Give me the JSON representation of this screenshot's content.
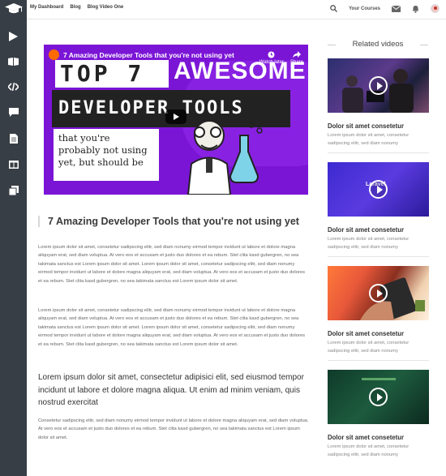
{
  "topbar": {
    "links": [
      "My Dashboard",
      "Blog",
      "Blog Video One"
    ],
    "courses_label": "Your Courses"
  },
  "sidebar": {
    "items": [
      {
        "icon": "play-icon"
      },
      {
        "icon": "book-icon"
      },
      {
        "icon": "code-icon"
      },
      {
        "icon": "chat-icon"
      },
      {
        "icon": "document-icon"
      },
      {
        "icon": "columns-icon"
      },
      {
        "icon": "copy-icon"
      }
    ]
  },
  "video": {
    "title": "7 Amazing Developer Tools that you're not using yet",
    "watch_later": "Watch later",
    "share": "Share",
    "thumb_top": "TOP 7",
    "thumb_awesome": "AWESOME",
    "thumb_devtools": "DEVELOPER TOOLS",
    "thumb_subtitle": "that you're probably not using yet, but should be"
  },
  "article": {
    "title": "7 Amazing Developer Tools that you're not using yet",
    "para1": "Lorem ipsum dolor sit amet, consetetur sadipscing elitr, sed diam nonumy eirmod tempor invidunt ut labore et dolore magna aliquyam erat, sed diam voluptua. At vero eos et accusam et justo duo dolores et ea rebum. Stet clita kasd gubergren, no sea takimata sanctus est Lorem ipsum dolor sit amet. Lorem ipsum dolor sit amet, consetetur sadipscing elitr, sed diam nonumy eirmod tempor invidunt ut labore et dolore magna aliquyam erat, sed diam voluptua. At vero eos et accusam et justo duo dolores et ea rebum. Stet clita kasd gubergren, no sea takimata sanctus est Lorem ipsum dolor sit amet.",
    "para2": "Lorem ipsum dolor sit amet, consetetur sadipscing elitr, sed diam nonumy eirmod tempor invidunt ut labore et dolore magna aliquyam erat, sed diam voluptua. At vero eos et accusam et justo duo dolores et ea rebum. Stet clita kasd gubergren, no sea takimata sanctus est Lorem ipsum dolor sit amet. Lorem ipsum dolor sit amet, consetetur sadipscing elitr, sed diam nonumy eirmod tempor invidunt ut labore et dolore magna aliquyam erat, sed diam voluptua. At vero eos et accusam et justo duo dolores et ea rebum. Stet clita kasd gubergren, no sea takimata sanctus est Lorem ipsum dolor sit amet.",
    "lead": "Lorem ipsum dolor sit amet, consectetur adipisici elit, sed eiusmod tempor incidunt ut labore et dolore magna aliqua. Ut enim ad minim veniam, quis nostrud exercitat",
    "para3": "Consetetur sadipscing elitr, sed diam nonumy eirmod tempor invidunt ut labore et dolore magna aliquyam erat, sed diam voluptua. At vero eos et accusam et justo duo dolores et ea rebum. Stet clita kasd gubergren, no sea takimata sanctus est Lorem ipsum dolor sit amet."
  },
  "related": {
    "header": "Related videos",
    "items": [
      {
        "title": "Dolor sit amet consetetur",
        "desc": "Lorem ipsum dolor sit amet, consetetur sadipscing elitr, sed diam nonumy"
      },
      {
        "title": "Dolor sit amet consetetur",
        "desc": "Lorem ipsum dolor sit amet, consetetur sadipscing elitr, sed diam nonumy",
        "thumb_text": "Laravel"
      },
      {
        "title": "Dolor sit amet consetetur",
        "desc": "Lorem ipsum dolor sit amet, consetetur sadipscing elitr, sed diam nonumy"
      },
      {
        "title": "Dolor sit amet consetetur",
        "desc": "Lorem ipsum dolor sit amet, consetetur sadipscing elitr, sed diam nonumy"
      }
    ]
  },
  "colors": {
    "sidebar": "#383e45",
    "video_bg": "#7b15d6",
    "thumb2_bg": "#4a2bd0",
    "thumb4_bg": "#1d5b3e"
  }
}
